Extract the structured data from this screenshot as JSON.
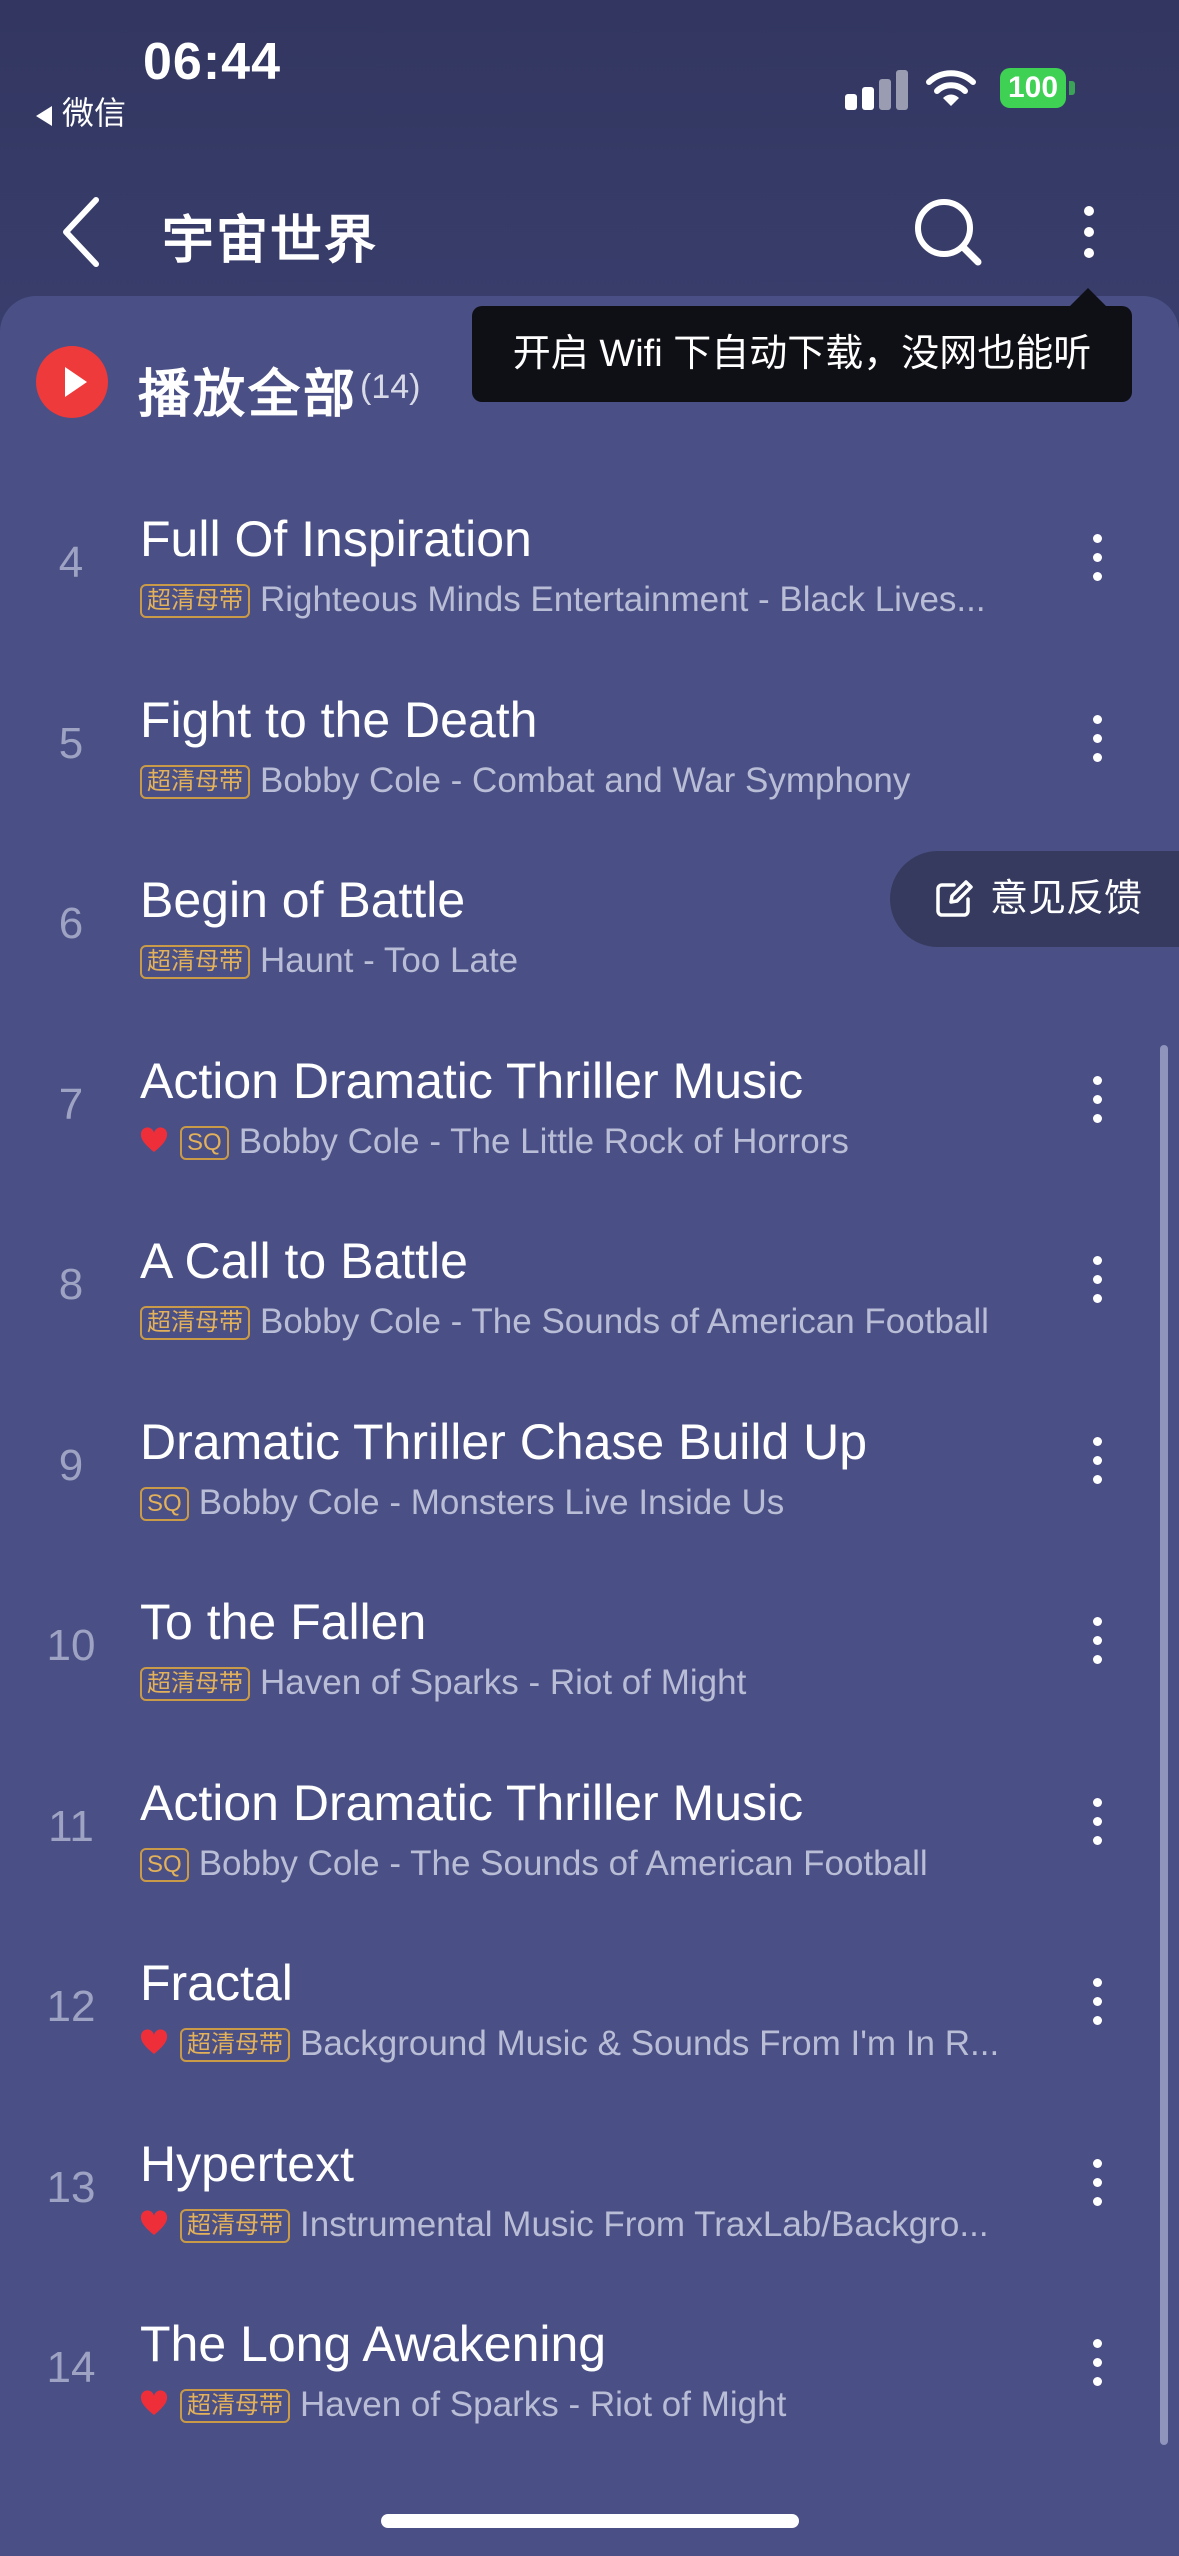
{
  "status_bar": {
    "time": "06:44",
    "back_app": "微信",
    "battery": "100"
  },
  "header": {
    "title": "宇宙世界",
    "back_icon": "chevron-left-icon",
    "search_icon": "search-icon",
    "more_icon": "more-vertical-icon"
  },
  "play_all": {
    "label": "播放全部",
    "count": "(14)"
  },
  "tooltip": {
    "text": "开启 Wifi 下自动下载，没网也能听"
  },
  "feedback": {
    "label": "意见反馈",
    "icon": "edit-icon"
  },
  "colors": {
    "accent": "#ee3a3a",
    "badge": "#e3b15a",
    "background": "#4a5085"
  },
  "tracks": [
    {
      "num": "4",
      "title": "Full Of Inspiration",
      "liked": false,
      "badge": "超清母带",
      "meta": "Righteous Minds Entertainment - Black Lives..."
    },
    {
      "num": "5",
      "title": "Fight to the Death",
      "liked": false,
      "badge": "超清母带",
      "meta": "Bobby Cole - Combat and War Symphony"
    },
    {
      "num": "6",
      "title": "Begin of Battle",
      "liked": false,
      "badge": "超清母带",
      "meta": "Haunt - Too Late"
    },
    {
      "num": "7",
      "title": "Action Dramatic Thriller Music",
      "liked": true,
      "badge": "SQ",
      "meta": "Bobby Cole - The Little Rock of Horrors"
    },
    {
      "num": "8",
      "title": "A Call to Battle",
      "liked": false,
      "badge": "超清母带",
      "meta": "Bobby Cole - The Sounds of American Football"
    },
    {
      "num": "9",
      "title": "Dramatic Thriller Chase Build Up",
      "liked": false,
      "badge": "SQ",
      "meta": "Bobby Cole - Monsters Live Inside Us"
    },
    {
      "num": "10",
      "title": "To the Fallen",
      "liked": false,
      "badge": "超清母带",
      "meta": "Haven of Sparks - Riot of Might"
    },
    {
      "num": "11",
      "title": "Action Dramatic Thriller Music",
      "liked": false,
      "badge": "SQ",
      "meta": "Bobby Cole - The Sounds of American Football"
    },
    {
      "num": "12",
      "title": "Fractal",
      "liked": true,
      "badge": "超清母带",
      "meta": "Background Music & Sounds From I'm In R..."
    },
    {
      "num": "13",
      "title": "Hypertext",
      "liked": true,
      "badge": "超清母带",
      "meta": "Instrumental Music From TraxLab/Backgro..."
    },
    {
      "num": "14",
      "title": "The Long Awakening",
      "liked": true,
      "badge": "超清母带",
      "meta": "Haven of Sparks - Riot of Might"
    }
  ]
}
